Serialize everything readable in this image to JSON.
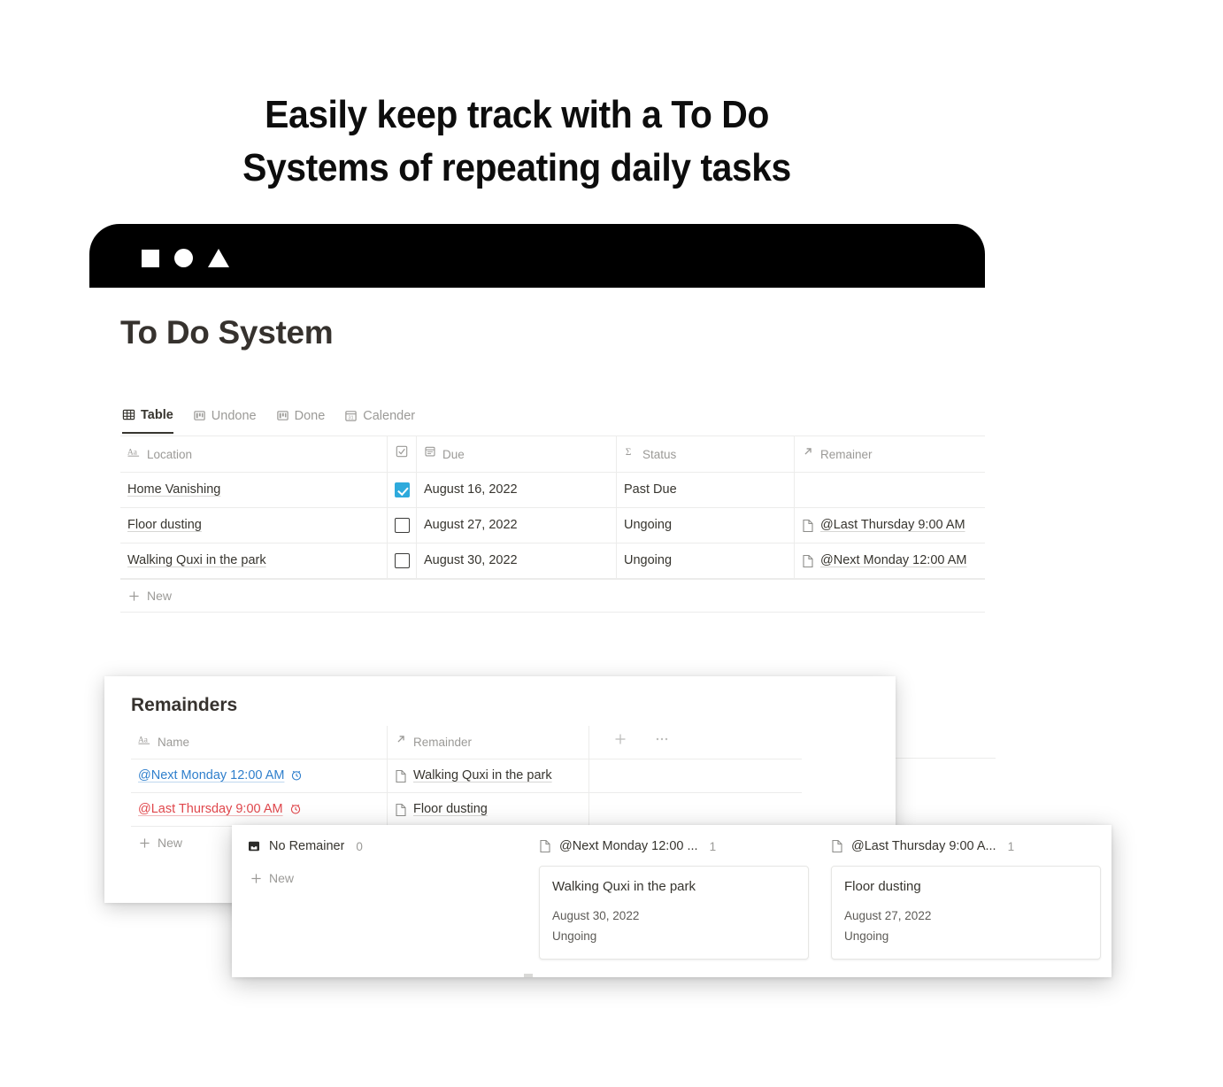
{
  "headline": {
    "line1": "Easily keep track with a To Do",
    "line2": "Systems of repeating daily tasks"
  },
  "chrome": {
    "shapes": [
      "square",
      "circle",
      "triangle"
    ]
  },
  "page": {
    "title": "To Do System"
  },
  "view_tabs": [
    {
      "label": "Table",
      "icon": "table-icon",
      "active": true
    },
    {
      "label": "Undone",
      "icon": "board-icon",
      "active": false
    },
    {
      "label": "Done",
      "icon": "board-icon",
      "active": false
    },
    {
      "label": "Calender",
      "icon": "calendar-icon",
      "active": false
    }
  ],
  "main_table": {
    "columns": [
      {
        "label": "Location",
        "icon": "text-aa-icon"
      },
      {
        "label": "",
        "icon": "checkbox-icon"
      },
      {
        "label": "Due",
        "icon": "date-icon"
      },
      {
        "label": "Status",
        "icon": "sigma-icon"
      },
      {
        "label": "Remainer",
        "icon": "relation-arrow-icon"
      }
    ],
    "rows": [
      {
        "location": "Home Vanishing",
        "checked": true,
        "due": "August 16, 2022",
        "status": "Past Due",
        "remainer": ""
      },
      {
        "location": "Floor dusting",
        "checked": false,
        "due": "August 27, 2022",
        "status": "Ungoing",
        "remainer": "@Last Thursday 9:00 AM"
      },
      {
        "location": "Walking Quxi in the park",
        "checked": false,
        "due": "August 30, 2022",
        "status": "Ungoing",
        "remainer": "@Next Monday 12:00 AM"
      }
    ],
    "new_label": "New"
  },
  "remainders_panel": {
    "title": "Remainders",
    "columns": [
      {
        "label": "Name",
        "icon": "text-aa-icon"
      },
      {
        "label": "Remainder",
        "icon": "relation-arrow-icon"
      }
    ],
    "add_icon": "plus-icon",
    "more_icon": "ellipsis-icon",
    "rows": [
      {
        "name": "@Next Monday 12:00 AM",
        "name_color": "#2f7fcc",
        "clock_icon": "alarm-clock-icon",
        "remainder": "Walking Quxi in the park"
      },
      {
        "name": "@Last Thursday 9:00 AM",
        "name_color": "#e0474c",
        "clock_icon": "alarm-clock-icon",
        "remainder": "Floor dusting"
      }
    ],
    "new_label": "New"
  },
  "board_panel": {
    "columns": [
      {
        "title": "No Remainer",
        "icon": "inbox-icon",
        "count": "0",
        "new_label": "New",
        "cards": []
      },
      {
        "title": "@Next Monday 12:00 ...",
        "icon": "page-icon",
        "count": "1",
        "cards": [
          {
            "title": "Walking Quxi in the park",
            "date": "August 30, 2022",
            "status": "Ungoing"
          }
        ]
      },
      {
        "title": "@Last Thursday 9:00 A...",
        "icon": "page-icon",
        "count": "1",
        "cards": [
          {
            "title": "Floor dusting",
            "date": "August 27, 2022",
            "status": "Ungoing"
          }
        ]
      }
    ]
  },
  "colors": {
    "accent_blue": "#2eaadc",
    "tag_blue": "#2f7fcc",
    "tag_red": "#e0474c",
    "text": "#37352f",
    "muted": "#9b9a97",
    "chrome": "#000000"
  }
}
